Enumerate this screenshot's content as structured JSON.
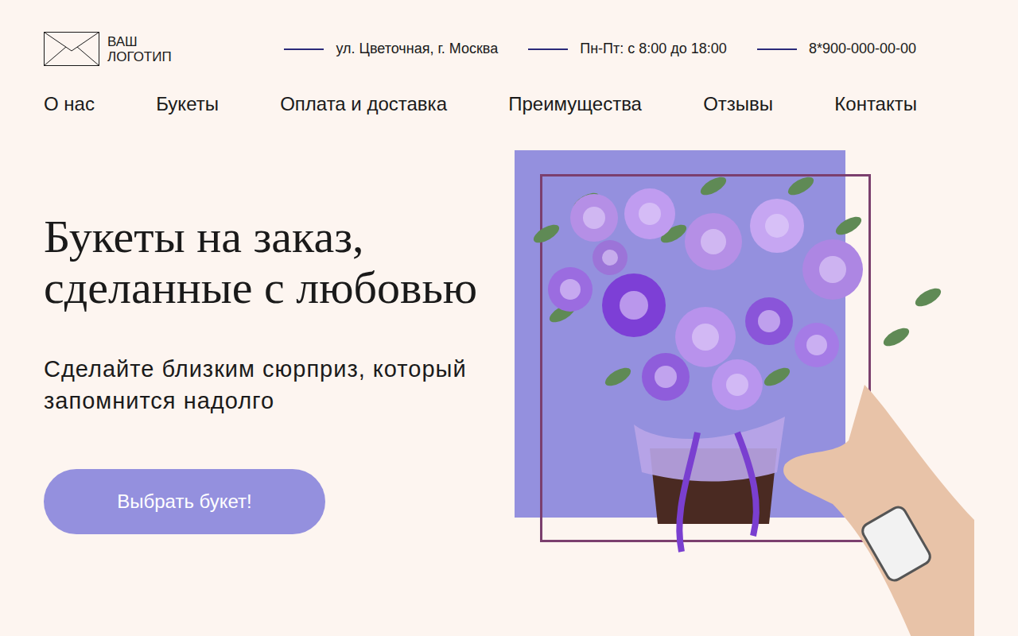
{
  "logo": {
    "line1": "ВАШ",
    "line2": "ЛОГОТИП"
  },
  "info": [
    {
      "text": "ул. Цветочная, г. Москва"
    },
    {
      "text": "Пн-Пт: с 8:00 до 18:00"
    },
    {
      "text": "8*900-000-00-00"
    }
  ],
  "nav": [
    {
      "label": "О нас"
    },
    {
      "label": "Букеты"
    },
    {
      "label": "Оплата и доставка"
    },
    {
      "label": "Преимущества"
    },
    {
      "label": "Отзывы"
    },
    {
      "label": "Контакты"
    }
  ],
  "hero": {
    "title_line1": "Букеты на заказ,",
    "title_line2": "сделанные с любовью",
    "subtitle": "Сделайте близким сюрприз, который запомнится надолго",
    "button": "Выбрать букет!"
  }
}
